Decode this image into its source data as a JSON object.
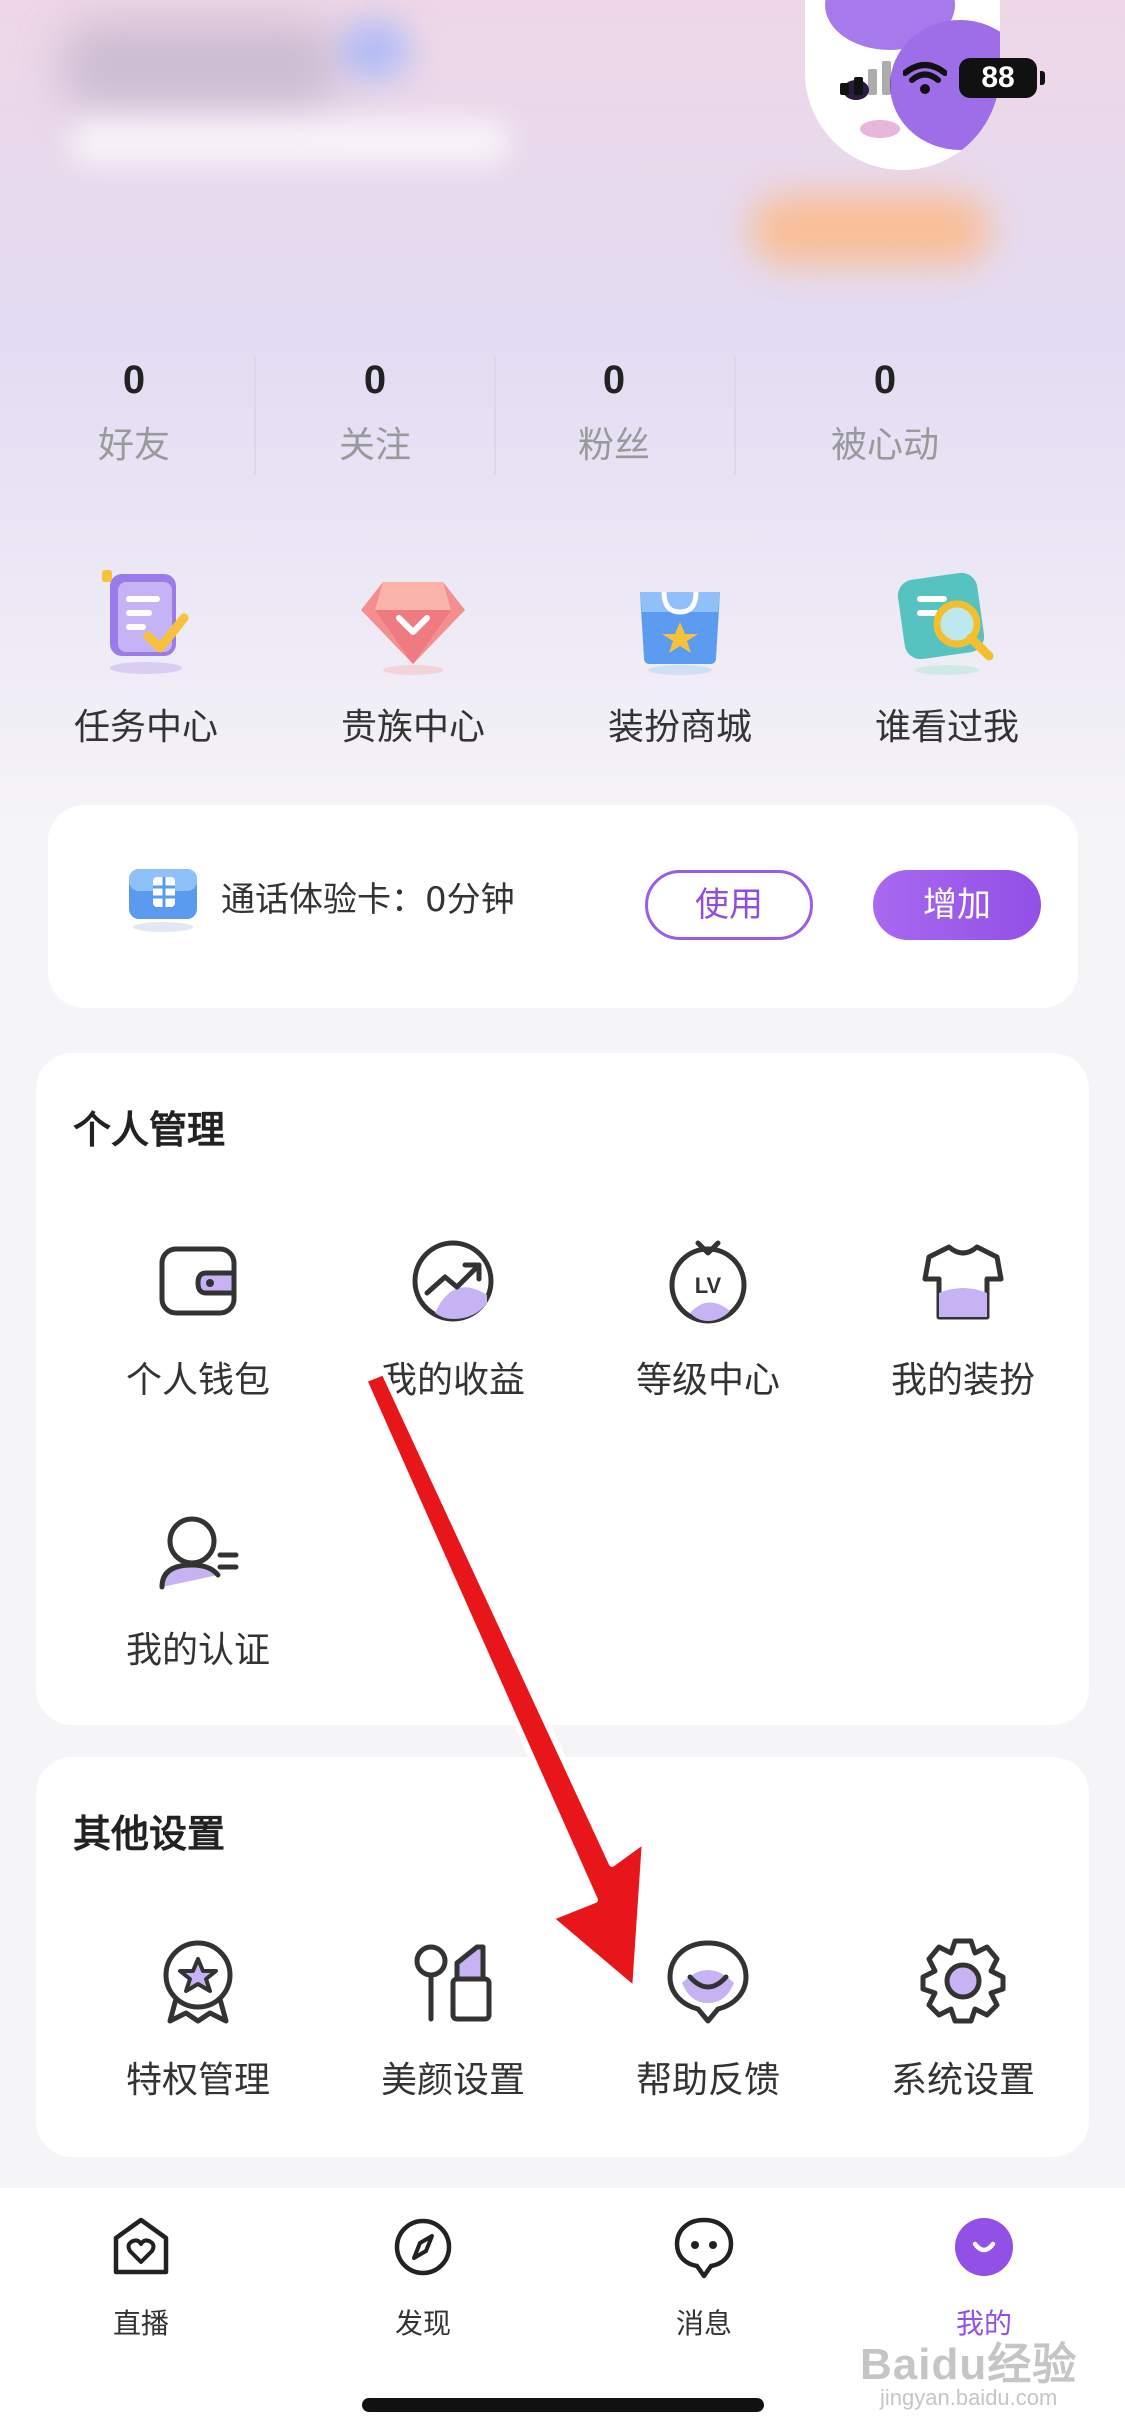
{
  "status_bar": {
    "battery": "88"
  },
  "stats": [
    {
      "value": "0",
      "label": "好友"
    },
    {
      "value": "0",
      "label": "关注"
    },
    {
      "value": "0",
      "label": "粉丝"
    },
    {
      "value": "0",
      "label": "被心动"
    }
  ],
  "quick_links": [
    {
      "label": "任务中心",
      "icon": "task-icon"
    },
    {
      "label": "贵族中心",
      "icon": "diamond-icon"
    },
    {
      "label": "装扮商城",
      "icon": "shopping-bag-icon"
    },
    {
      "label": "谁看过我",
      "icon": "magnifier-icon"
    }
  ],
  "call_card": {
    "text": "通话体验卡：0分钟",
    "use_label": "使用",
    "add_label": "增加",
    "accent": "#9350e6"
  },
  "personal": {
    "title": "个人管理",
    "items": [
      {
        "label": "个人钱包",
        "icon": "wallet-icon"
      },
      {
        "label": "我的收益",
        "icon": "earnings-icon"
      },
      {
        "label": "等级中心",
        "icon": "level-icon"
      },
      {
        "label": "我的装扮",
        "icon": "outfit-icon"
      },
      {
        "label": "我的认证",
        "icon": "verification-icon"
      }
    ]
  },
  "other": {
    "title": "其他设置",
    "items": [
      {
        "label": "特权管理",
        "icon": "privilege-icon"
      },
      {
        "label": "美颜设置",
        "icon": "beauty-icon"
      },
      {
        "label": "帮助反馈",
        "icon": "feedback-icon"
      },
      {
        "label": "系统设置",
        "icon": "gear-icon"
      }
    ]
  },
  "tabbar": [
    {
      "label": "直播",
      "icon": "live-icon",
      "active": false
    },
    {
      "label": "发现",
      "icon": "compass-icon",
      "active": false
    },
    {
      "label": "消息",
      "icon": "message-icon",
      "active": false
    },
    {
      "label": "我的",
      "icon": "profile-icon",
      "active": true
    }
  ],
  "watermark": {
    "brand": "Baidu经验",
    "url": "jingyan.baidu.com"
  },
  "annotation_color": "#e8161a"
}
